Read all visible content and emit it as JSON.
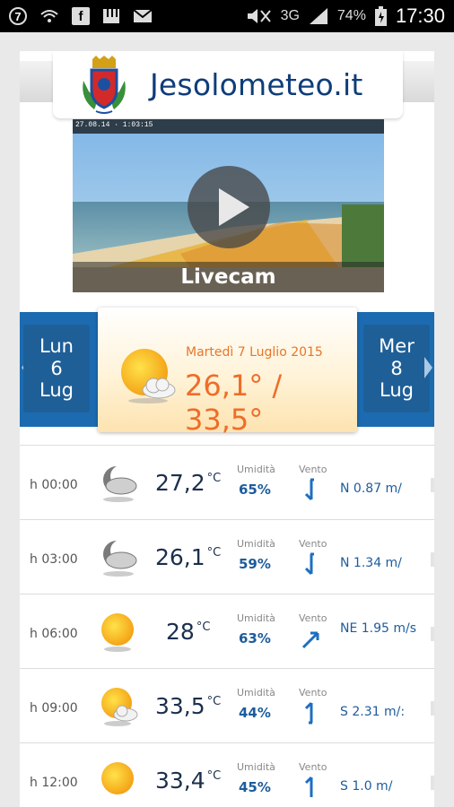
{
  "status_bar": {
    "notification_badge": "7",
    "battery": "74%",
    "network": "3G",
    "time": "17:30",
    "icons": [
      "notification-badge-icon",
      "wifi-icon",
      "facebook-icon",
      "piano-icon",
      "mail-icon",
      "mute-icon",
      "signal-icon",
      "battery-icon"
    ]
  },
  "header": {
    "title": "Jesolometeo.it",
    "logo_icon": "jesolo-crest-icon"
  },
  "livecam": {
    "timestamp": "27.08.14 · 1:03:15",
    "label": "Livecam",
    "play_icon": "play-icon"
  },
  "days": {
    "prev": {
      "weekday": "Lun",
      "day": "6",
      "month": "Lug"
    },
    "current": {
      "date": "Martedì 7 Luglio 2015",
      "temps": "26,1° / 33,5°",
      "icon": "sun-cloud-icon"
    },
    "next": {
      "weekday": "Mer",
      "day": "8",
      "month": "Lug"
    }
  },
  "labels": {
    "humidity": "Umidità",
    "wind": "Vento",
    "deg_unit": "°C"
  },
  "hours": [
    {
      "hour": "h 00:00",
      "icon": "moon-cloud-icon",
      "temp": "27,2",
      "humidity": "65%",
      "wind": "N  0.87 m/",
      "direction": "N"
    },
    {
      "hour": "h 03:00",
      "icon": "moon-cloud-icon",
      "temp": "26,1",
      "humidity": "59%",
      "wind": "N  1.34 m/",
      "direction": "N"
    },
    {
      "hour": "h 06:00",
      "icon": "sun-icon",
      "temp": "28",
      "humidity": "63%",
      "wind": "NE  1.95 m/s",
      "direction": "NE"
    },
    {
      "hour": "h 09:00",
      "icon": "sun-cloud-icon",
      "temp": "33,5",
      "humidity": "44%",
      "wind": "S  2.31 m/:",
      "direction": "S"
    },
    {
      "hour": "h 12:00",
      "icon": "sun-icon",
      "temp": "33,4",
      "humidity": "45%",
      "wind": "S  1.0 m/",
      "direction": "S"
    }
  ],
  "colors": {
    "brand_blue": "#0f3d7a",
    "nav_blue": "#1c6bb1",
    "accent_orange": "#ee6d2a",
    "value_blue": "#1d5c9c"
  }
}
